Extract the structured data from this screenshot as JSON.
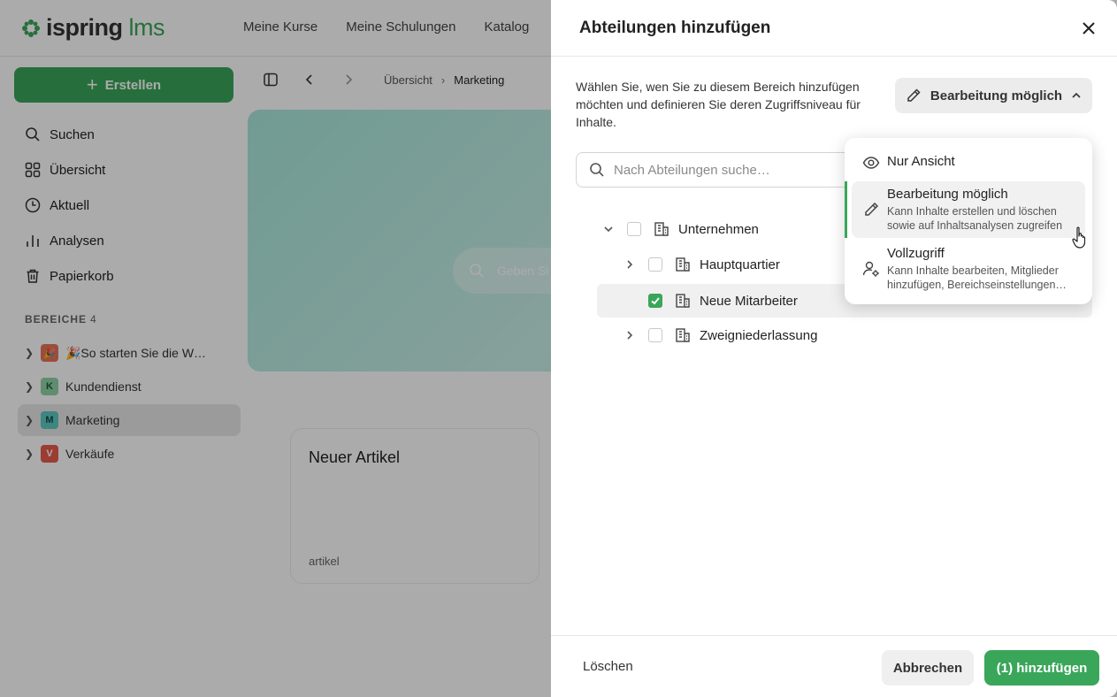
{
  "app": {
    "logo": {
      "brand": "ispring",
      "product": "lms"
    },
    "nav": [
      "Meine Kurse",
      "Meine Schulungen",
      "Katalog"
    ],
    "create_label": "Erstellen",
    "sidebar": [
      {
        "label": "Suchen",
        "icon": "search-icon"
      },
      {
        "label": "Übersicht",
        "icon": "grid-icon"
      },
      {
        "label": "Aktuell",
        "icon": "clock-icon"
      },
      {
        "label": "Analysen",
        "icon": "bar-chart-icon"
      },
      {
        "label": "Papierkorb",
        "icon": "trash-icon"
      }
    ],
    "spaces_title": "BEREICHE",
    "spaces_count": "4",
    "spaces": [
      {
        "label": "🎉So starten Sie die W…",
        "badge": "🎉",
        "color": "#e8735a"
      },
      {
        "label": "Kundendienst",
        "badge": "K",
        "color": "#8fd3a8"
      },
      {
        "label": "Marketing",
        "badge": "M",
        "color": "#5fc7c0"
      },
      {
        "label": "Verkäufe",
        "badge": "V",
        "color": "#e85c4a"
      }
    ],
    "breadcrumb": [
      "Übersicht",
      "Marketing"
    ],
    "hero_search_placeholder": "Geben Si",
    "article": {
      "title": "Neuer Artikel",
      "subtitle": "artikel"
    }
  },
  "panel": {
    "title": "Abteilungen hinzufügen",
    "description": "Wählen Sie, wen Sie zu diesem Bereich hinzufügen möchten und definieren Sie deren Zugriffsniveau für Inhalte.",
    "access_button": "Bearbeitung möglich",
    "search_placeholder": "Nach Abteilungen suche…",
    "tree": [
      {
        "label": "Unternehmen",
        "checked": false
      },
      {
        "label": "Hauptquartier",
        "checked": false
      },
      {
        "label": "Neue Mitarbeiter",
        "checked": true
      },
      {
        "label": "Zweigniederlassung",
        "checked": false
      }
    ],
    "footer": {
      "delete": "Löschen",
      "cancel": "Abbrechen",
      "add": "(1) hinzufügen"
    }
  },
  "dropdown": {
    "options": [
      {
        "label": "Nur Ansicht",
        "icon": "eye-icon",
        "description": ""
      },
      {
        "label": "Bearbeitung möglich",
        "icon": "pencil-icon",
        "description": "Kann Inhalte erstellen und löschen sowie auf Inhaltsanalysen zugreifen",
        "selected": true
      },
      {
        "label": "Vollzugriff",
        "icon": "user-gear-icon",
        "description": "Kann Inhalte bearbeiten, Mitglieder hinzufügen, Bereichseinstellungen…"
      }
    ]
  },
  "colors": {
    "accent": "#3aa65a",
    "overlay": "rgba(0,0,0,0.33)"
  }
}
